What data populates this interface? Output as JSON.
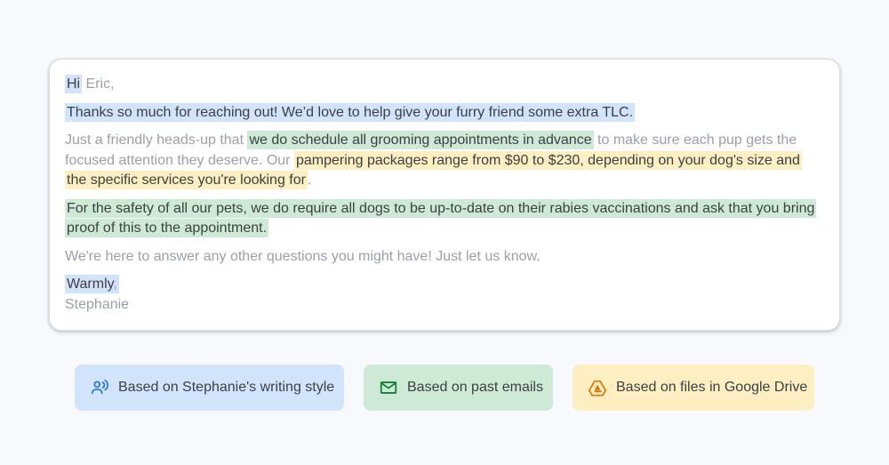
{
  "email": {
    "greeting": {
      "hi": "Hi",
      "name": " Eric,"
    },
    "thanks": "Thanks so much for reaching out! We’d love to help give your furry friend some extra TLC.",
    "paragraph3": {
      "intro": "Just a friendly heads-up that ",
      "highlight1": "we do schedule all grooming appointments in advance",
      "middle": " to make sure each pup gets the focused attention they deserve. Our ",
      "highlight2": "pampering packages range from $90 to $230, depending on your dog's size and the specific services you're looking for",
      "end": "."
    },
    "safety": "For the safety of all our pets, we do require all dogs to be up-to-date on their rabies vaccinations and ask that you bring proof of this to the appointment.",
    "questions": "We're here to answer any other questions you might have! Just let us know.",
    "signoff": {
      "word": "Warmly",
      "comma": ","
    },
    "signature": "Stephanie"
  },
  "chips": {
    "writing_style": "Based on Stephanie's writing style",
    "past_emails": "Based on past emails",
    "drive_files": "Based on files in Google Drive"
  },
  "colors": {
    "blue_highlight": "#d2e3fc",
    "green_highlight": "#ceead6",
    "yellow_highlight": "#feefc3",
    "blue_icon": "#1a73e8",
    "green_icon": "#188038",
    "yellow_icon": "#e37400"
  },
  "icons": {
    "writing_style": "voice-person-icon",
    "past_emails": "mail-icon",
    "drive_files": "google-drive-icon"
  }
}
